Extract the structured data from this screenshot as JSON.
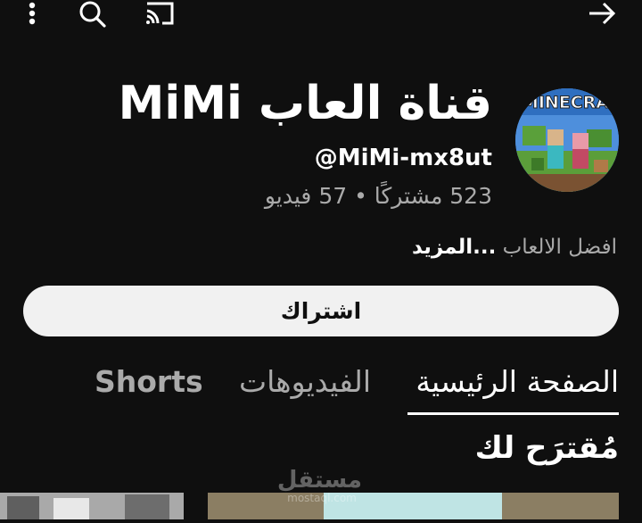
{
  "topbar": {
    "icons": [
      "more-vert-icon",
      "search-icon",
      "cast-icon",
      "arrow-forward-icon"
    ]
  },
  "channel": {
    "name": "قناة العاب MiMi",
    "handle": "@MiMi-mx8ut",
    "stats": "523 مشتركًا • 57 فيديو",
    "avatar_text": "MINECRA",
    "description": "افضل الالعاب",
    "more_label": "...المزيد"
  },
  "subscribe_label": "اشتراك",
  "tabs": [
    {
      "label": "الصفحة الرئيسية",
      "active": true
    },
    {
      "label": "الفيديوهات",
      "active": false
    },
    {
      "label": "Shorts",
      "active": false
    }
  ],
  "section": {
    "title": "مُقترَح لك"
  },
  "watermark": {
    "line1": "مستقل",
    "line2": "mostaql.com"
  },
  "colors": {
    "background": "#0f0f0f",
    "text_primary": "#ffffff",
    "text_secondary": "#aaaaaa",
    "button_bg": "#f1f1f1"
  }
}
